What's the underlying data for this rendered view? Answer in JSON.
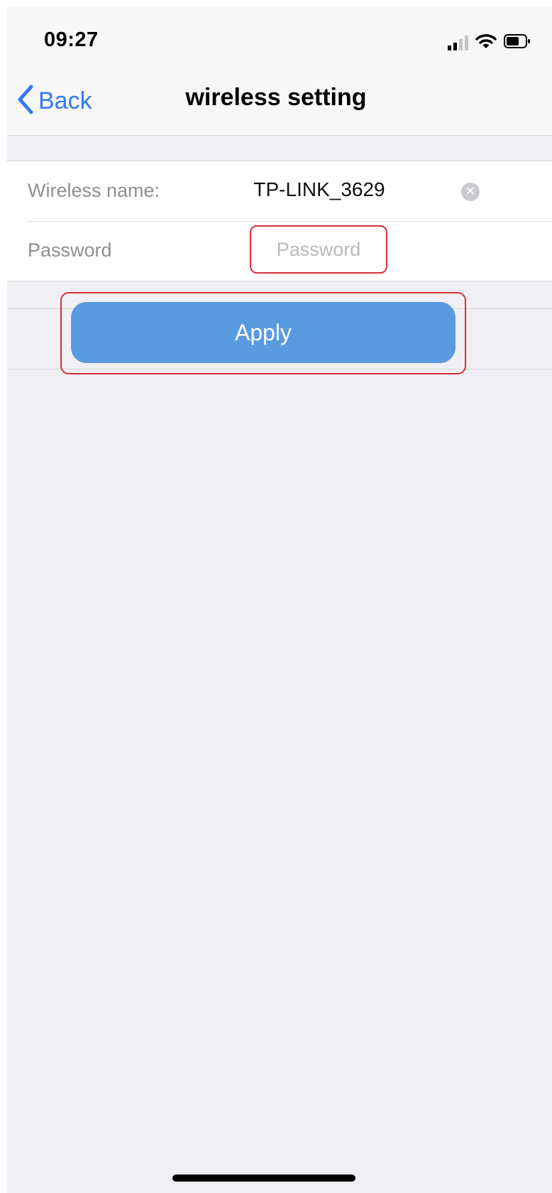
{
  "status_bar": {
    "time": "09:27",
    "icons": [
      "cellular-signal-icon",
      "wifi-icon",
      "battery-icon"
    ]
  },
  "nav": {
    "back_label": "Back",
    "title": "wireless setting"
  },
  "form": {
    "wireless_name_label": "Wireless name:",
    "wireless_name_value": "TP-LINK_3629",
    "password_label": "Password",
    "password_placeholder": "Password",
    "password_value": ""
  },
  "apply_button": {
    "label": "Apply"
  },
  "colors": {
    "accent": "#3478f6",
    "button": "#5a9ade",
    "highlight": "#d9303a",
    "background": "#efeff4"
  }
}
